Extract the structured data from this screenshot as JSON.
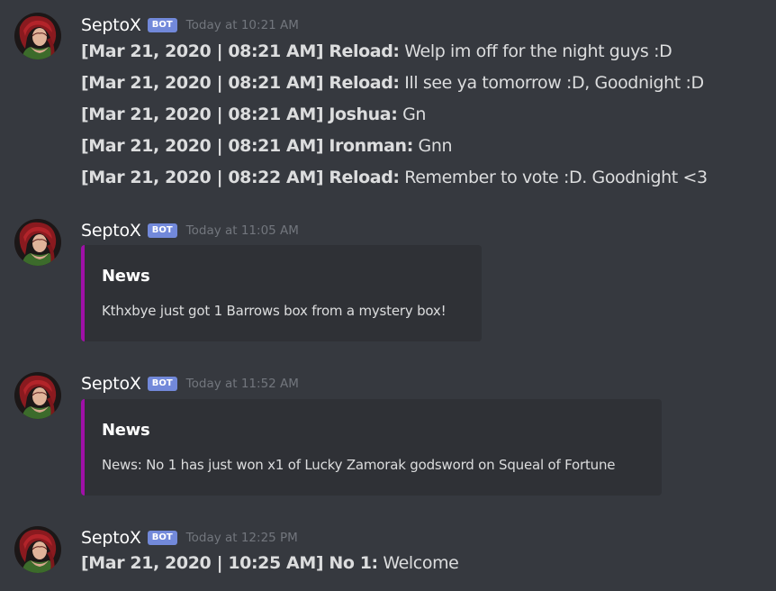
{
  "colors": {
    "background": "#36393f",
    "embed_background": "#2f3136",
    "embed_accent": "#a010a8",
    "bot_tag": "#7289da",
    "timestamp": "#72767d",
    "text": "#dcddde"
  },
  "messages": [
    {
      "author": "SeptoX",
      "tag": "BOT",
      "time": "Today at 10:21 AM",
      "avatar_icon": "character-portrait",
      "lines": [
        {
          "prefix": "[Mar 21, 2020 | 08:21 AM] Reload:",
          "text": " Welp im off for the night guys :D"
        },
        {
          "prefix": "[Mar 21, 2020 | 08:21 AM] Reload:",
          "text": " Ill see ya tomorrow :D, Goodnight :D"
        },
        {
          "prefix": "[Mar 21, 2020 | 08:21 AM] Joshua:",
          "text": " Gn"
        },
        {
          "prefix": "[Mar 21, 2020 | 08:21 AM] Ironman:",
          "text": " Gnn"
        },
        {
          "prefix": "[Mar 21, 2020 | 08:22 AM] Reload:",
          "text": " Remember to vote :D. Goodnight <3"
        }
      ]
    },
    {
      "author": "SeptoX",
      "tag": "BOT",
      "time": "Today at 11:05 AM",
      "avatar_icon": "character-portrait",
      "embed": {
        "title": "News",
        "description": "Kthxbye just got 1 Barrows box from a mystery box!"
      }
    },
    {
      "author": "SeptoX",
      "tag": "BOT",
      "time": "Today at 11:52 AM",
      "avatar_icon": "character-portrait",
      "embed": {
        "title": "News",
        "description": "News: No 1 has just won x1 of Lucky Zamorak godsword on Squeal of Fortune"
      }
    },
    {
      "author": "SeptoX",
      "tag": "BOT",
      "time": "Today at 12:25 PM",
      "avatar_icon": "character-portrait",
      "lines": [
        {
          "prefix": "[Mar 21, 2020 | 10:25 AM] No 1:",
          "text": " Welcome"
        }
      ]
    }
  ]
}
